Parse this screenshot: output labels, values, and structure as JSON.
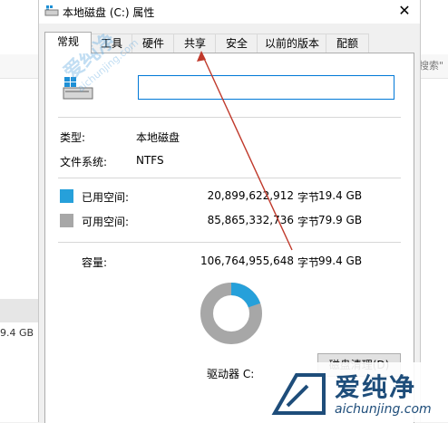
{
  "background": {
    "search_placeholder": "搜索\"",
    "drive_size": "9.4 GB"
  },
  "dialog": {
    "title": "本地磁盘 (C:) 属性",
    "close": "✕",
    "tabs": [
      "常规",
      "工具",
      "硬件",
      "共享",
      "安全",
      "以前的版本",
      "配额"
    ],
    "active_tab": "常规",
    "name_value": "",
    "type_label": "类型:",
    "type_value": "本地磁盘",
    "fs_label": "文件系统:",
    "fs_value": "NTFS",
    "used_label": "已用空间:",
    "used_bytes": "20,899,622,912",
    "used_unit": "字节",
    "used_gb": "19.4 GB",
    "free_label": "可用空间:",
    "free_bytes": "85,865,332,736",
    "free_unit": "字节",
    "free_gb": "79.9 GB",
    "cap_label": "容量:",
    "cap_bytes": "106,764,955,648",
    "cap_unit": "字节",
    "cap_gb": "99.4 GB",
    "drive_label": "驱动器 C:",
    "cleanup_button": "磁盘清理(D)",
    "used_fraction": 0.1958,
    "colors": {
      "used": "#26a0da",
      "free": "#a7a7a7",
      "accent": "#0078d7"
    }
  },
  "watermark": {
    "cn": "爱纯净",
    "url": "aichunjing.com"
  }
}
